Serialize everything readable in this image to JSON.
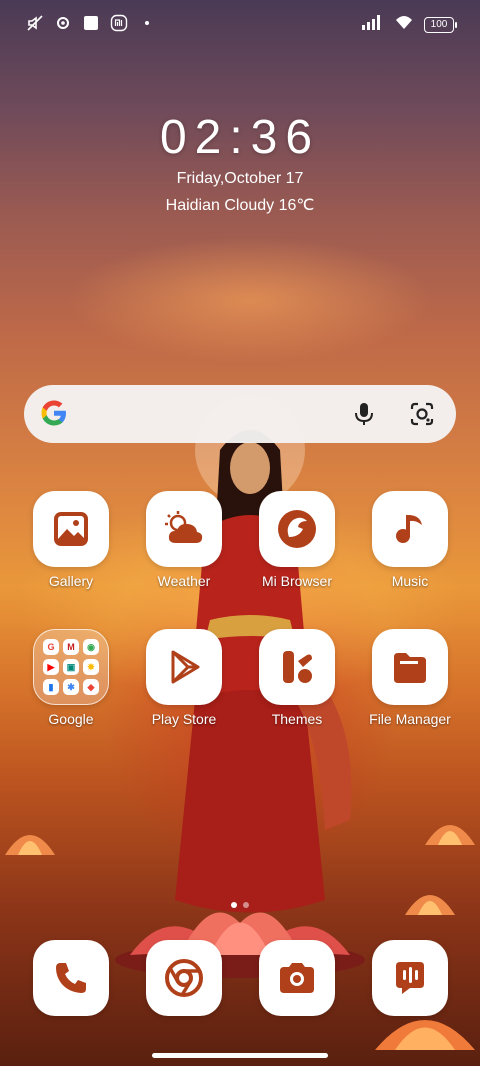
{
  "status_bar": {
    "battery": "100"
  },
  "clock": {
    "time": "02:36",
    "date": "Friday,October 17",
    "weather": "Haidian Cloudy 16℃"
  },
  "search": {
    "icons": [
      "google-logo",
      "microphone-icon",
      "google-lens-icon"
    ]
  },
  "accent_color": "#b0401a",
  "apps_row1": [
    {
      "label": "Gallery",
      "icon": "gallery-icon"
    },
    {
      "label": "Weather",
      "icon": "weather-icon"
    },
    {
      "label": "Mi Browser",
      "icon": "browser-icon"
    },
    {
      "label": "Music",
      "icon": "music-icon"
    }
  ],
  "apps_row2": [
    {
      "label": "Google",
      "icon": "folder-icon"
    },
    {
      "label": "Play Store",
      "icon": "play-store-icon"
    },
    {
      "label": "Themes",
      "icon": "themes-icon"
    },
    {
      "label": "File Manager",
      "icon": "file-manager-icon"
    }
  ],
  "folder_minis": [
    "G",
    "M",
    "◉",
    "▶",
    "▣",
    "✸",
    "▮",
    "✱",
    "◆"
  ],
  "page_indicator": {
    "pages": 2,
    "current": 1
  },
  "dock": [
    {
      "icon": "phone-icon"
    },
    {
      "icon": "chrome-icon"
    },
    {
      "icon": "camera-icon"
    },
    {
      "icon": "messages-icon"
    }
  ]
}
